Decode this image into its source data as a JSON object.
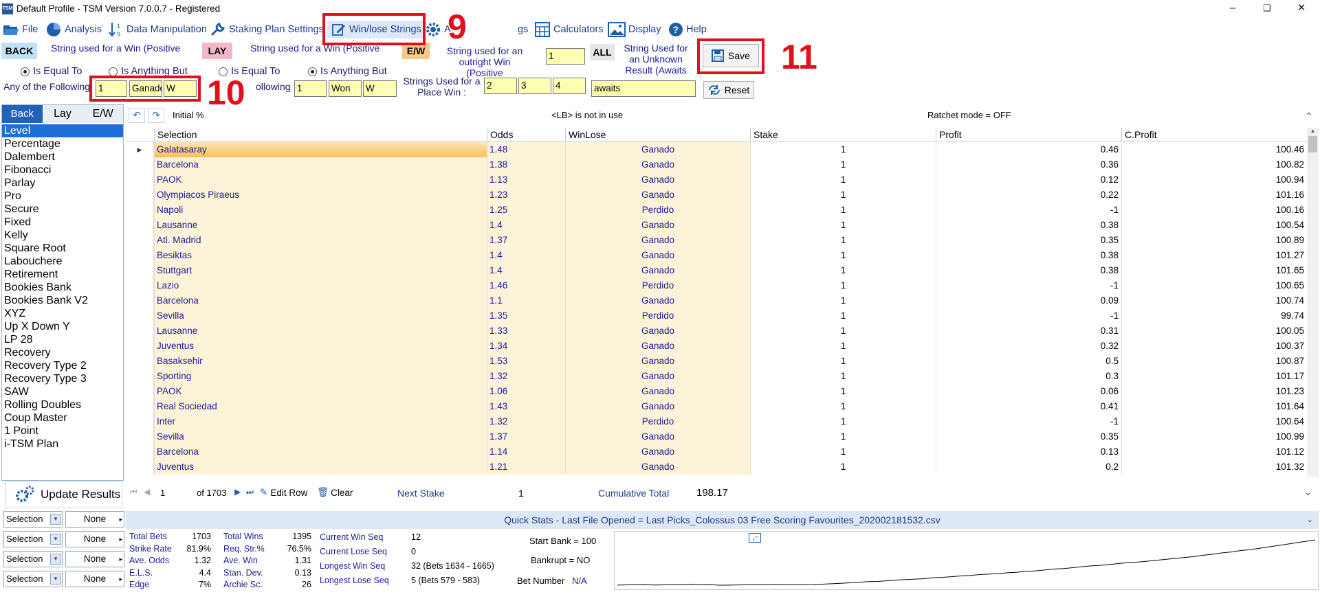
{
  "window": {
    "title": "Default Profile  - TSM Version 7.0.0.7 - Registered",
    "app_icon": "TSM"
  },
  "menu": [
    {
      "label": "File",
      "icon": "folder-icon"
    },
    {
      "label": "Analysis",
      "icon": "pie-chart-icon"
    },
    {
      "label": "Data Manipulation",
      "icon": "sort-icon"
    },
    {
      "label": "Staking Plan Settings",
      "icon": "wrench-icon"
    },
    {
      "label": "Win/lose Strings",
      "icon": "edit-icon"
    },
    {
      "label": "A",
      "icon": "gear-icon"
    },
    {
      "label": "gs",
      "icon": ""
    },
    {
      "label": "Calculators",
      "icon": "calculator-icon"
    },
    {
      "label": "Display",
      "icon": "image-icon"
    },
    {
      "label": "Help",
      "icon": "help-icon"
    }
  ],
  "annotations": {
    "n9": "9",
    "n10": "10",
    "n11": "11",
    "color": "#e2101c"
  },
  "back": {
    "tag": "BACK",
    "desc": "String used for a Win (Positive",
    "eq": "Is Equal To",
    "anybut": "Is Anything But",
    "following": "Any of the Following",
    "v1": "1",
    "v2": "Ganado",
    "v3": "W"
  },
  "lay": {
    "tag": "LAY",
    "desc": "String used for a Win (Positive",
    "eq": "Is Equal To",
    "anybut": "Is Anything But",
    "following": "Any of the Following",
    "v1": "1",
    "v2": "Won",
    "v3": "W",
    "following_visible": "ollowing"
  },
  "ew": {
    "tag": "E/W",
    "outright": "String used for an outright Win (Positive",
    "outright_val": "1",
    "place": "Strings Used for a Place Win :",
    "p1": "2",
    "p2": "3",
    "p3": "4"
  },
  "all": {
    "tag": "ALL",
    "desc": "String Used for an Unknown Result  (Awaits",
    "val": "awaits"
  },
  "buttons": {
    "save": "Save",
    "reset": "Reset",
    "update": "Update Results",
    "edit_row": "Edit Row",
    "clear": "Clear"
  },
  "left_tabs": [
    "Back",
    "Lay",
    "E/W"
  ],
  "plans": [
    "Level",
    "Percentage",
    "Dalembert",
    "Fibonacci",
    "Parlay",
    "Pro",
    "Secure",
    "Fixed",
    "Kelly",
    "Square Root",
    "Labouchere",
    "Retirement",
    "Bookies Bank",
    "Bookies Bank V2",
    "XYZ",
    "Up X Down Y",
    "LP 28",
    "Recovery",
    "Recovery Type 2",
    "Recovery Type 3",
    "SAW",
    "Rolling Doubles",
    "Coup Master",
    "1 Point",
    "i-TSM Plan"
  ],
  "filters": [
    {
      "sel": "Selection",
      "val": "None"
    },
    {
      "sel": "Selection",
      "val": "None"
    },
    {
      "sel": "Selection",
      "val": "None"
    },
    {
      "sel": "Selection",
      "val": "None"
    }
  ],
  "grid_toolbar": {
    "initial": "Initial %",
    "lb": "<LB> is not in use",
    "ratchet": "Ratchet mode = OFF"
  },
  "columns": [
    "Selection",
    "Odds",
    "WinLose",
    "Stake",
    "Profit",
    "C.Profit"
  ],
  "rows": [
    [
      "Galatasaray",
      "1.48",
      "Ganado",
      "1",
      "0.46",
      "100.46"
    ],
    [
      "Barcelona",
      "1.38",
      "Ganado",
      "1",
      "0.36",
      "100.82"
    ],
    [
      "PAOK",
      "1.13",
      "Ganado",
      "1",
      "0.12",
      "100.94"
    ],
    [
      "Olympiacos Piraeus",
      "1.23",
      "Ganado",
      "1",
      "0.22",
      "101.16"
    ],
    [
      "Napoli",
      "1.25",
      "Perdido",
      "1",
      "-1",
      "100.16"
    ],
    [
      "Lausanne",
      "1.4",
      "Ganado",
      "1",
      "0.38",
      "100.54"
    ],
    [
      "Atl. Madrid",
      "1.37",
      "Ganado",
      "1",
      "0.35",
      "100.89"
    ],
    [
      "Besiktas",
      "1.4",
      "Ganado",
      "1",
      "0.38",
      "101.27"
    ],
    [
      "Stuttgart",
      "1.4",
      "Ganado",
      "1",
      "0.38",
      "101.65"
    ],
    [
      "Lazio",
      "1.46",
      "Perdido",
      "1",
      "-1",
      "100.65"
    ],
    [
      "Barcelona",
      "1.1",
      "Ganado",
      "1",
      "0.09",
      "100.74"
    ],
    [
      "Sevilla",
      "1.35",
      "Perdido",
      "1",
      "-1",
      "99.74"
    ],
    [
      "Lausanne",
      "1.33",
      "Ganado",
      "1",
      "0.31",
      "100.05"
    ],
    [
      "Juventus",
      "1.34",
      "Ganado",
      "1",
      "0.32",
      "100.37"
    ],
    [
      "Basaksehir",
      "1.53",
      "Ganado",
      "1",
      "0.5",
      "100.87"
    ],
    [
      "Sporting",
      "1.32",
      "Ganado",
      "1",
      "0.3",
      "101.17"
    ],
    [
      "PAOK",
      "1.06",
      "Ganado",
      "1",
      "0.06",
      "101.23"
    ],
    [
      "Real Sociedad",
      "1.43",
      "Ganado",
      "1",
      "0.41",
      "101.64"
    ],
    [
      "Inter",
      "1.32",
      "Perdido",
      "1",
      "-1",
      "100.64"
    ],
    [
      "Sevilla",
      "1.37",
      "Ganado",
      "1",
      "0.35",
      "100.99"
    ],
    [
      "Barcelona",
      "1.14",
      "Ganado",
      "1",
      "0.13",
      "101.12"
    ],
    [
      "Juventus",
      "1.21",
      "Ganado",
      "1",
      "0.2",
      "101.32"
    ]
  ],
  "nav": {
    "page": "1",
    "of": "of 1703",
    "next_stake_label": "Next Stake",
    "next_stake": "1",
    "cum_label": "Cumulative Total",
    "cum": "198.17"
  },
  "quickstats_title": "Quick Stats - Last File Opened = Last Picks_Colossus 03 Free Scoring Favourites_202002181532.csv",
  "stats1": [
    [
      "Total Bets",
      "1703"
    ],
    [
      "Strike Rate",
      "81.9%"
    ],
    [
      "Ave. Odds",
      "1.32"
    ],
    [
      "E.L.S.",
      "4.4"
    ],
    [
      "Edge",
      "7%"
    ]
  ],
  "stats2": [
    [
      "Total Wins",
      "1395"
    ],
    [
      "Req. Str.%",
      "76.5%"
    ],
    [
      "Ave. Win",
      "1.31"
    ],
    [
      "Stan. Dev.",
      "0.13"
    ],
    [
      "Archie Sc.",
      "26"
    ]
  ],
  "stats3": [
    [
      "Current Win Seq",
      "12"
    ],
    [
      "Current Lose Seq",
      "0"
    ],
    [
      "Longest Win Seq",
      "32  (Bets 1634 - 1665)"
    ],
    [
      "Longest Lose Seq",
      "5  (Bets 579 - 583)"
    ]
  ],
  "bank": {
    "start": "Start Bank = 100",
    "bankrupt": "Bankrupt = NO",
    "betnum_label": "Bet Number",
    "betnum": "N/A"
  },
  "sparkline": [
    100,
    100.5,
    101,
    101.2,
    100.2,
    100.6,
    101,
    101.3,
    101.7,
    100.7,
    100.8,
    99.8,
    100,
    100.4,
    100.9,
    101.2,
    101.2,
    101.6,
    100.6,
    101,
    101.1,
    101.3,
    102,
    103,
    104,
    105,
    106,
    107.5,
    108,
    109.5,
    111,
    112,
    113,
    114,
    116,
    117,
    118.5,
    120,
    121,
    123,
    124,
    125,
    127,
    128,
    130,
    131,
    133,
    135,
    136,
    138,
    140,
    142,
    143,
    145,
    147,
    149,
    150,
    152,
    154,
    156,
    158,
    160,
    162,
    165,
    167,
    170,
    172,
    175,
    177,
    180,
    183,
    186,
    189,
    192,
    195,
    198.17
  ]
}
